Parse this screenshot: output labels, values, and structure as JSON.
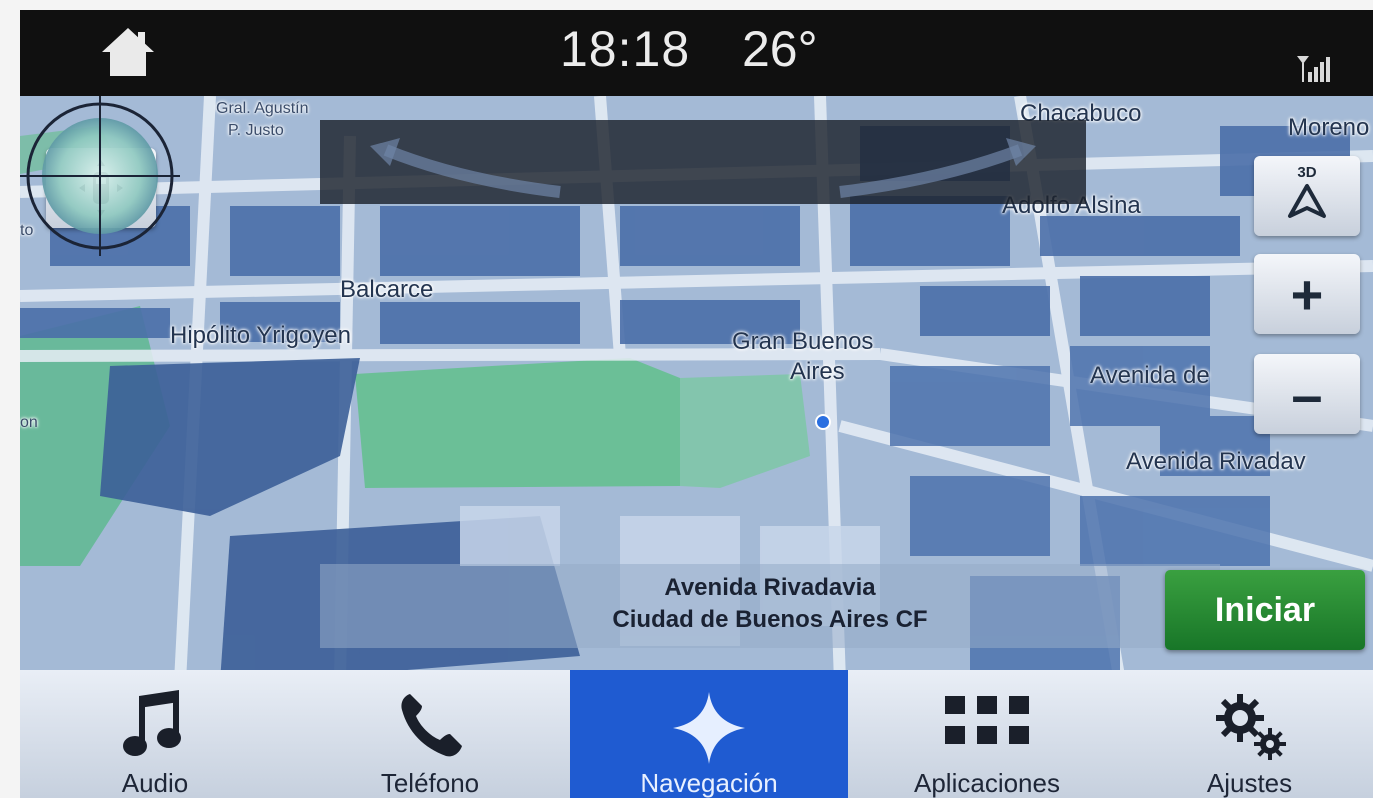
{
  "status_bar": {
    "time": "18:18",
    "temperature": "26°",
    "home_icon": "home-icon",
    "signal_icon": "signal-strength-icon"
  },
  "map": {
    "street_labels": {
      "gral_agustin": "Gral. Agustín",
      "p_justo": "P. Justo",
      "chacabuco": "Chacabuco",
      "moreno": "Moreno",
      "adolfo_alsina": "Adolfo Alsina",
      "balcarce": "Balcarce",
      "hipolito_yrigoyen": "Hipólito Yrigoyen",
      "gran_buenos": "Gran Buenos",
      "aires": "Aires",
      "avenida_de": "Avenida de",
      "avenida_rivadav": "Avenida Rivadav",
      "left_partial_to": "to",
      "left_partial_on": "on"
    },
    "controls": {
      "recenter_icon": "recenter-icon",
      "view_3d_label": "3D",
      "compass_icon": "compass-arrow-icon",
      "zoom_in_label": "+",
      "zoom_out_label": "–"
    }
  },
  "destination": {
    "line1": "Avenida Rivadavia",
    "line2": "Ciudad de Buenos Aires CF",
    "start_label": "Iniciar"
  },
  "bottom_nav": {
    "items": [
      {
        "label": "Audio",
        "icon": "music-note-icon"
      },
      {
        "label": "Teléfono",
        "icon": "phone-icon"
      },
      {
        "label": "Navegación",
        "icon": "navigation-star-icon"
      },
      {
        "label": "Aplicaciones",
        "icon": "apps-grid-icon"
      },
      {
        "label": "Ajustes",
        "icon": "settings-gears-icon"
      }
    ],
    "active_index": 2
  },
  "colors": {
    "status_bar_bg": "#101010",
    "active_tab": "#1f5bd1",
    "start_button": "#2a8a34",
    "map_block": "#4a6fa8",
    "map_park": "#5fb890"
  }
}
